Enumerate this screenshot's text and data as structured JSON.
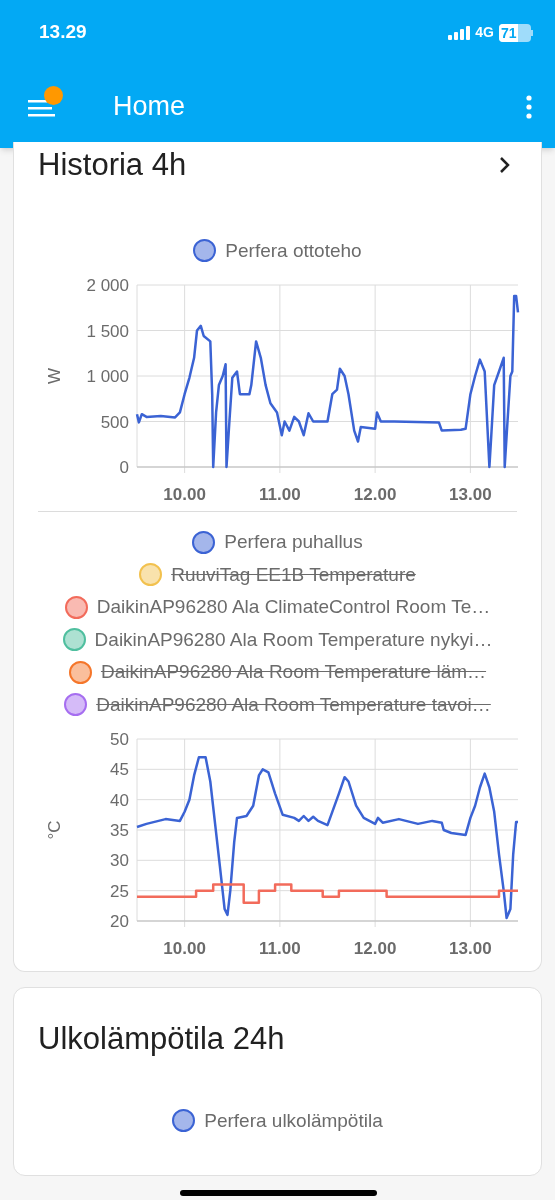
{
  "status_bar": {
    "time": "13.29",
    "network": "4G",
    "battery": "71"
  },
  "app_bar": {
    "title": "Home",
    "notification": true
  },
  "cards": [
    {
      "title": "Historia 4h",
      "has_link": true,
      "charts": [
        {
          "legend_struck": [
            false
          ],
          "chart_data": {
            "type": "line",
            "grid": true,
            "ylabel": "W",
            "xlim": [
              9.5,
              13.5
            ],
            "ylim": [
              0,
              2000
            ],
            "xticks": [
              {
                "value": 10,
                "label": "10.00"
              },
              {
                "value": 11,
                "label": "11.00"
              },
              {
                "value": 12,
                "label": "12.00"
              },
              {
                "value": 13,
                "label": "13.00"
              }
            ],
            "yticks": [
              {
                "value": 0,
                "label": "0"
              },
              {
                "value": 500,
                "label": "500"
              },
              {
                "value": 1000,
                "label": "1 000"
              },
              {
                "value": 1500,
                "label": "1 500"
              },
              {
                "value": 2000,
                "label": "2 000"
              }
            ],
            "series": [
              {
                "name": "Perfera ottoteho",
                "color": "#3b63d4",
                "x": [
                  9.5,
                  9.52,
                  9.55,
                  9.6,
                  9.75,
                  9.9,
                  9.95,
                  10.0,
                  10.05,
                  10.1,
                  10.13,
                  10.17,
                  10.2,
                  10.27,
                  10.29,
                  10.3,
                  10.33,
                  10.36,
                  10.4,
                  10.43,
                  10.44,
                  10.47,
                  10.5,
                  10.55,
                  10.58,
                  10.68,
                  10.7,
                  10.75,
                  10.8,
                  10.85,
                  10.9,
                  10.97,
                  11.02,
                  11.05,
                  11.1,
                  11.15,
                  11.2,
                  11.25,
                  11.3,
                  11.35,
                  11.5,
                  11.55,
                  11.6,
                  11.63,
                  11.68,
                  11.72,
                  11.78,
                  11.82,
                  11.85,
                  12.0,
                  12.02,
                  12.06,
                  12.2,
                  12.67,
                  12.7,
                  12.9,
                  12.95,
                  13.0,
                  13.05,
                  13.1,
                  13.15,
                  13.2,
                  13.22,
                  13.25,
                  13.3,
                  13.35,
                  13.36,
                  13.39,
                  13.42,
                  13.44,
                  13.46,
                  13.48,
                  13.5
                ],
                "values": [
                  580,
                  490,
                  580,
                  550,
                  560,
                  545,
                  600,
                  800,
                  980,
                  1200,
                  1500,
                  1550,
                  1440,
                  1380,
                  800,
                  0,
                  600,
                  900,
                  1000,
                  1130,
                  0,
                  500,
                  980,
                  1050,
                  800,
                  800,
                  900,
                  1380,
                  1200,
                  900,
                  700,
                  600,
                  350,
                  500,
                  400,
                  550,
                  500,
                  350,
                  590,
                  500,
                  500,
                  800,
                  850,
                  1080,
                  1000,
                  800,
                  400,
                  280,
                  440,
                  420,
                  600,
                  500,
                  500,
                  490,
                  400,
                  410,
                  420,
                  800,
                  1000,
                  1180,
                  1050,
                  0,
                  350,
                  900,
                  1050,
                  1200,
                  0,
                  500,
                  1000,
                  1050,
                  1880,
                  1880,
                  1700
                ]
              }
            ]
          }
        },
        {
          "legend_struck": [
            false,
            true,
            false,
            false,
            true,
            true
          ],
          "chart_data": {
            "type": "line",
            "grid": true,
            "ylabel": "°C",
            "xlim": [
              9.5,
              13.5
            ],
            "ylim": [
              20,
              50
            ],
            "xticks": [
              {
                "value": 10,
                "label": "10.00"
              },
              {
                "value": 11,
                "label": "11.00"
              },
              {
                "value": 12,
                "label": "12.00"
              },
              {
                "value": 13,
                "label": "13.00"
              }
            ],
            "yticks": [
              20,
              25,
              30,
              35,
              40,
              45,
              50
            ],
            "series": [
              {
                "name": "Perfera puhallus",
                "color": "#3b63d4",
                "x": [
                  9.5,
                  9.6,
                  9.8,
                  9.95,
                  10.0,
                  10.05,
                  10.1,
                  10.15,
                  10.22,
                  10.27,
                  10.32,
                  10.37,
                  10.42,
                  10.45,
                  10.48,
                  10.52,
                  10.55,
                  10.65,
                  10.72,
                  10.78,
                  10.82,
                  10.88,
                  10.95,
                  11.03,
                  11.15,
                  11.2,
                  11.25,
                  11.3,
                  11.35,
                  11.4,
                  11.5,
                  11.55,
                  11.62,
                  11.68,
                  11.72,
                  11.8,
                  11.88,
                  12.0,
                  12.03,
                  12.08,
                  12.25,
                  12.45,
                  12.6,
                  12.7,
                  12.72,
                  12.8,
                  12.95,
                  13.0,
                  13.05,
                  13.1,
                  13.15,
                  13.2,
                  13.25,
                  13.3,
                  13.35,
                  13.38,
                  13.42,
                  13.45,
                  13.48,
                  13.5
                ],
                "values": [
                  35.5,
                  36,
                  36.8,
                  36.5,
                  38,
                  40,
                  44,
                  47,
                  47,
                  43,
                  36,
                  29,
                  22,
                  21,
                  25,
                  33,
                  37,
                  37.3,
                  39,
                  44,
                  45,
                  44.5,
                  41,
                  37.5,
                  37,
                  36.5,
                  37.3,
                  36.5,
                  37.2,
                  36.5,
                  35.8,
                  38,
                  41,
                  43.7,
                  43,
                  39,
                  37,
                  36,
                  37,
                  36.2,
                  36.8,
                  36,
                  36.5,
                  36.2,
                  35,
                  34.5,
                  34.2,
                  37,
                  39,
                  42,
                  44.3,
                  42,
                  38,
                  31,
                  25,
                  20.5,
                  22,
                  31,
                  36.3,
                  36.3
                ]
              },
              {
                "name": "RuuviTag EE1B Temperature",
                "color": "#f2c14e"
              },
              {
                "name": "DaikinAP96280 Ala ClimateControl Room Te…",
                "color": "#f26b5b",
                "x": [
                  9.5,
                  10.12,
                  10.12,
                  10.3,
                  10.3,
                  10.62,
                  10.62,
                  10.78,
                  10.78,
                  10.95,
                  10.95,
                  11.12,
                  11.12,
                  11.45,
                  11.45,
                  11.62,
                  11.62,
                  12.12,
                  12.12,
                  13.3,
                  13.3,
                  13.5
                ],
                "values": [
                  24,
                  24,
                  25,
                  25,
                  26,
                  26,
                  23,
                  23,
                  25,
                  25,
                  26,
                  26,
                  25,
                  25,
                  24,
                  24,
                  25,
                  25,
                  24,
                  24,
                  25,
                  25
                ]
              },
              {
                "name": "DaikinAP96280 Ala Room Temperature nykyi…",
                "color": "#4fbf9f"
              },
              {
                "name": "DaikinAP96280 Ala Room Temperature läm…",
                "color": "#f5762a"
              },
              {
                "name": "DaikinAP96280 Ala Room Temperature tavoi…",
                "color": "#a66ef0"
              }
            ]
          }
        }
      ]
    },
    {
      "title": "Ulkolämpötila 24h",
      "has_link": false,
      "charts": [
        {
          "legend": [
            {
              "name": "Perfera ulkolämpötila",
              "color": "#3b63d4",
              "struck": false
            }
          ]
        }
      ]
    }
  ]
}
